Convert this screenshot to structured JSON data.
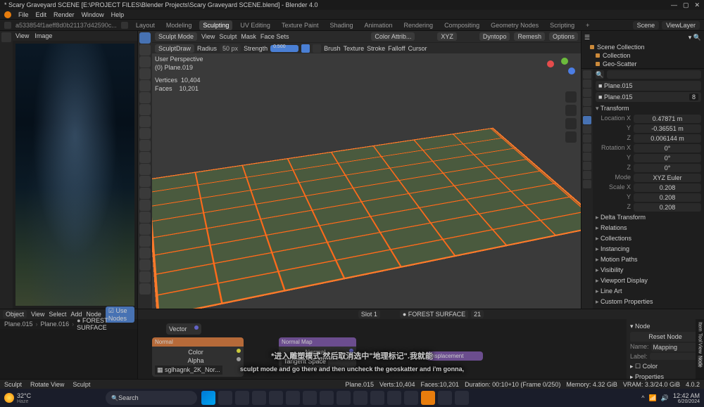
{
  "window": {
    "title": "* Scary Graveyard SCENE [E:\\PROJECT FILES\\Blender Projects\\Scary Graveyard SCENE.blend] - Blender 4.0"
  },
  "menu": [
    "File",
    "Edit",
    "Render",
    "Window",
    "Help"
  ],
  "workspaces": {
    "file_label": "a533854f1aeff8d0b21137d42590c...",
    "tabs": [
      "Layout",
      "Modeling",
      "Sculpting",
      "UV Editing",
      "Texture Paint",
      "Shading",
      "Animation",
      "Rendering",
      "Compositing",
      "Geometry Nodes",
      "Scripting"
    ],
    "active": "Sculpting",
    "scene": "Scene",
    "view_layer": "ViewLayer"
  },
  "image_header": {
    "items": [
      "View",
      "Image"
    ]
  },
  "vp_header": {
    "mode": "Sculpt Mode",
    "menus": [
      "View",
      "Sculpt",
      "Mask",
      "Face Sets"
    ],
    "color_attr_placeholder": "Color Attrib...",
    "xyz": "XYZ",
    "dyntopo": "Dyntopo",
    "remesh": "Remesh",
    "options": "Options"
  },
  "vp_header2": {
    "brush": "SculptDraw",
    "radius_label": "Radius",
    "radius": "50 px",
    "strength_label": "Strength",
    "strength": "0.500",
    "menus": [
      "Brush",
      "Texture",
      "Stroke",
      "Falloff",
      "Cursor"
    ]
  },
  "vp_overlay": {
    "view": "User Perspective",
    "obj": "(0) Plane.019",
    "verts_label": "Vertices",
    "verts": "10,404",
    "faces_label": "Faces",
    "faces": "10,201"
  },
  "outliner": {
    "title": "Scene Collection",
    "items": [
      "Collection",
      "Geo-Scatter"
    ]
  },
  "props": {
    "search_label": "search",
    "obj": "Plane.015",
    "obj2": "Plane.015",
    "transform_label": "Transform",
    "location_label": "Location X",
    "location_x": "0.47871 m",
    "location_y": "-0.36551 m",
    "location_z": "0.006144 m",
    "rotation_label": "Rotation X",
    "rotation_x": "0°",
    "rotation_y": "0°",
    "rotation_z": "0°",
    "mode_label": "Mode",
    "mode": "XYZ Euler",
    "scale_label": "Scale X",
    "scale_x": "0.208",
    "scale_y": "0.208",
    "scale_z": "0.208",
    "sections": [
      "Delta Transform",
      "Relations",
      "Collections",
      "Instancing",
      "Motion Paths",
      "Visibility",
      "Viewport Display",
      "Line Art",
      "Custom Properties"
    ]
  },
  "node_header": {
    "menus": [
      "View",
      "Select",
      "Add",
      "Node"
    ],
    "mode": "Object",
    "use_nodes": "Use Nodes",
    "slot": "Slot 1",
    "material": "FOREST SURFACE",
    "count": "21"
  },
  "breadcrumb": [
    "Plane.015",
    "Plane.016",
    "FOREST SURFACE"
  ],
  "nodes": {
    "vector": "Vector",
    "normal": "Normal",
    "normal_color": "Color",
    "normal_alpha": "Alpha",
    "normal_img": "sglhagnk_2K_Nor...",
    "normal_map": "Normal Map",
    "normal_out": "Normal",
    "normal_space": "Tangent Space",
    "displacement": "Displacement"
  },
  "n_panel": {
    "title": "Node",
    "reset": "Reset Node",
    "name_label": "Name:",
    "name": "Mapping",
    "label_label": "Label:",
    "color": "Color",
    "properties": "Properties",
    "tabs": [
      "Item",
      "Tool",
      "View",
      "Node"
    ]
  },
  "status": {
    "left": [
      "Sculpt",
      "Rotate View",
      "Sculpt"
    ],
    "right": {
      "obj": "Plane.015",
      "verts": "Verts:10,404",
      "faces": "Faces:10,201",
      "duration": "Duration: 00:10+10 (Frame 0/250)",
      "memory": "Memory: 4.32 GiB",
      "vram": "VRAM: 3.3/24.0 GiB",
      "version": "4.0.2"
    }
  },
  "taskbar": {
    "temp": "32°C",
    "haze": "Haze",
    "search": "Search",
    "time": "12:42 AM",
    "date": "6/20/2024"
  },
  "subtitle": {
    "cn": "*进入雕塑模式,然后取消选中\"地理标记\".我就能",
    "en": "sculpt mode and go there and then uncheck the geoskatter and i'm gonna,"
  }
}
